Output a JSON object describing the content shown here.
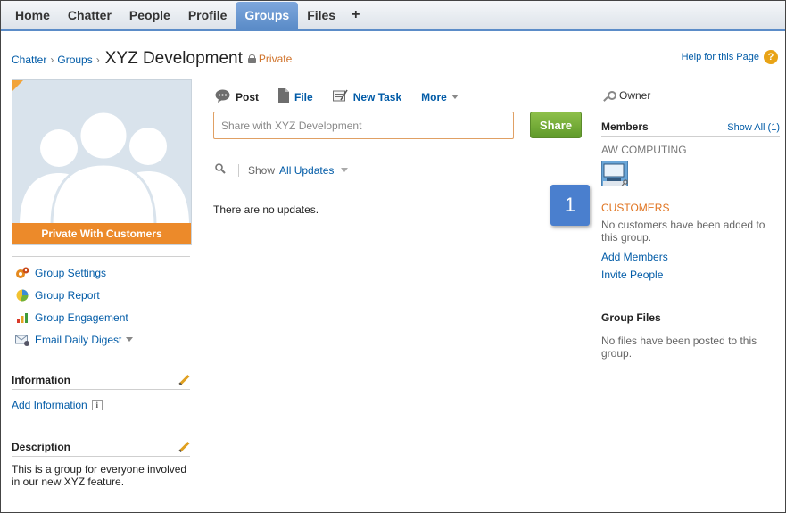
{
  "nav": {
    "tabs": [
      "Home",
      "Chatter",
      "People",
      "Profile",
      "Groups",
      "Files"
    ],
    "active_tab": "Groups",
    "plus_label": "+"
  },
  "breadcrumb": {
    "items": [
      "Chatter",
      "Groups"
    ],
    "separator": "›",
    "title": "XYZ Development",
    "privacy": "Private"
  },
  "help": {
    "label": "Help for this Page",
    "icon_text": "?"
  },
  "group_photo": {
    "banner": "Private With Customers"
  },
  "side_links": [
    {
      "label": "Group Settings",
      "icon": "settings-gear-icon"
    },
    {
      "label": "Group Report",
      "icon": "report-chart-icon"
    },
    {
      "label": "Group Engagement",
      "icon": "bar-chart-icon"
    },
    {
      "label": "Email Daily Digest",
      "icon": "email-icon"
    }
  ],
  "information": {
    "title": "Information",
    "add_label": "Add Information",
    "info_icon_text": "i"
  },
  "description": {
    "title": "Description",
    "text": "This is a group for everyone involved in our new XYZ feature."
  },
  "publisher": {
    "tabs": [
      "Post",
      "File",
      "New Task",
      "More"
    ],
    "placeholder": "Share with XYZ Development",
    "share_label": "Share"
  },
  "feed": {
    "show_label": "Show",
    "filter_value": "All Updates",
    "empty_text": "There are no updates."
  },
  "badge": {
    "value": "1"
  },
  "owner": {
    "label": "Owner"
  },
  "members": {
    "title": "Members",
    "show_all": "Show All (1)",
    "company": "AW COMPUTING",
    "customers_label": "CUSTOMERS",
    "customers_empty": "No customers have been added to this group.",
    "add_members": "Add Members",
    "invite_people": "Invite People"
  },
  "group_files": {
    "title": "Group Files",
    "empty_text": "No files have been posted to this group."
  },
  "colors": {
    "accent_blue": "#015ba7",
    "nav_active": "#5b8cc8",
    "orange": "#ec8a2a",
    "share_green": "#6fa83a",
    "badge_blue": "#4a7fce"
  }
}
